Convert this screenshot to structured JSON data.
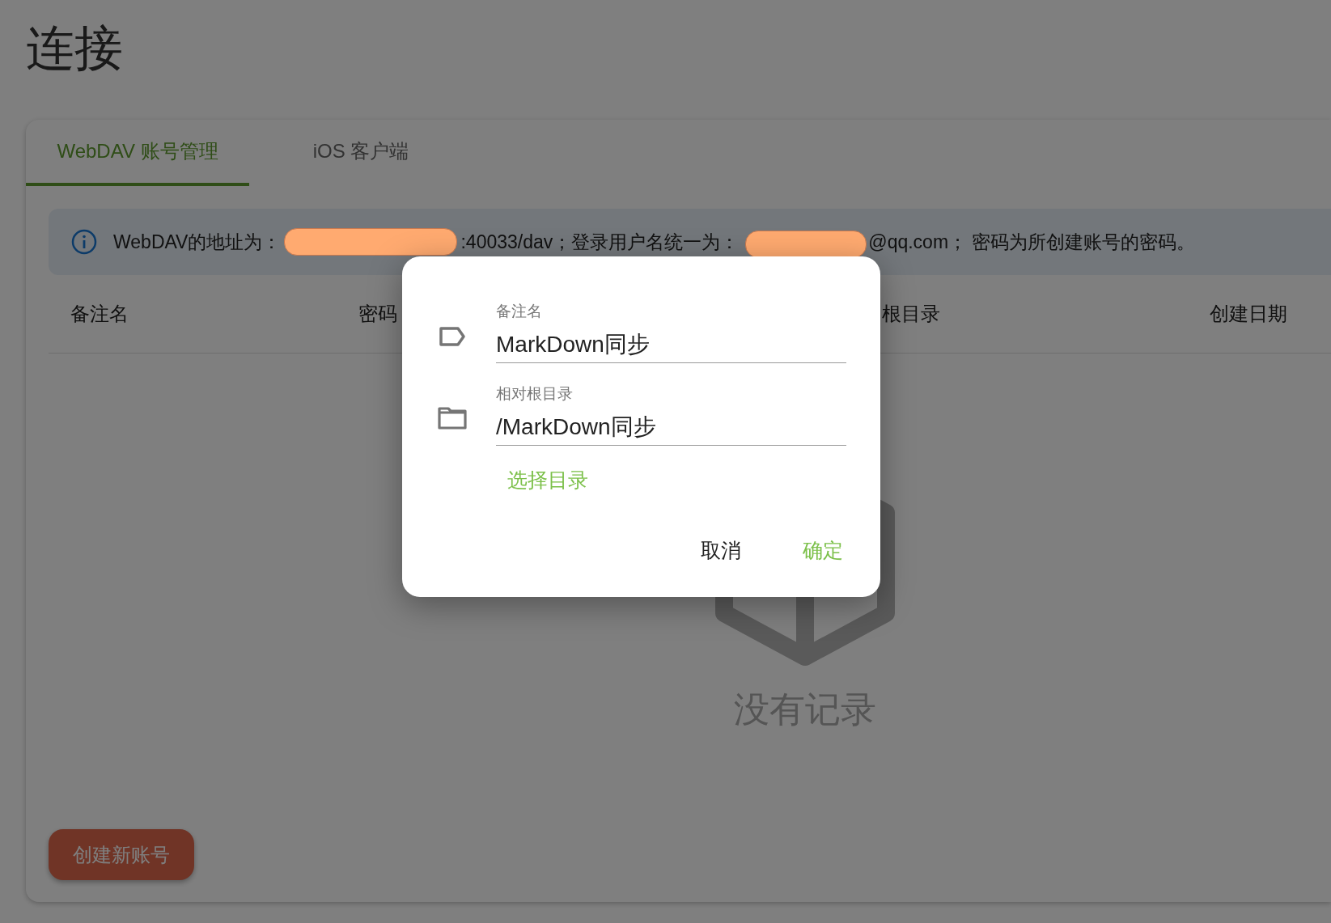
{
  "page": {
    "title": "连接"
  },
  "tabs": [
    {
      "label": "WebDAV 账号管理",
      "selected": true
    },
    {
      "label": "iOS 客户端",
      "selected": false
    }
  ],
  "info": {
    "parts": [
      {
        "kind": "text",
        "text": "WebDAV的地址为："
      },
      {
        "kind": "redacted"
      },
      {
        "kind": "text",
        "text": ":40033/dav；登录用户名统一为："
      },
      {
        "kind": "redacted"
      },
      {
        "kind": "text",
        "text": "@qq.com； 密码为所创建账号的密码。"
      }
    ]
  },
  "table": {
    "columns": [
      "备注名",
      "密码",
      "根目录",
      "创建日期"
    ]
  },
  "empty_state": {
    "text": "没有记录"
  },
  "create_button": {
    "label": "创建新账号"
  },
  "dialog": {
    "fields": [
      {
        "kind": "tag",
        "label": "备注名",
        "value": "MarkDown同步"
      },
      {
        "kind": "folder",
        "label": "相对根目录",
        "value": "/MarkDown同步"
      }
    ],
    "link": "选择目录",
    "actions": [
      {
        "kind": "cancel",
        "label": "取消"
      },
      {
        "kind": "confirm",
        "label": "确定"
      }
    ]
  }
}
